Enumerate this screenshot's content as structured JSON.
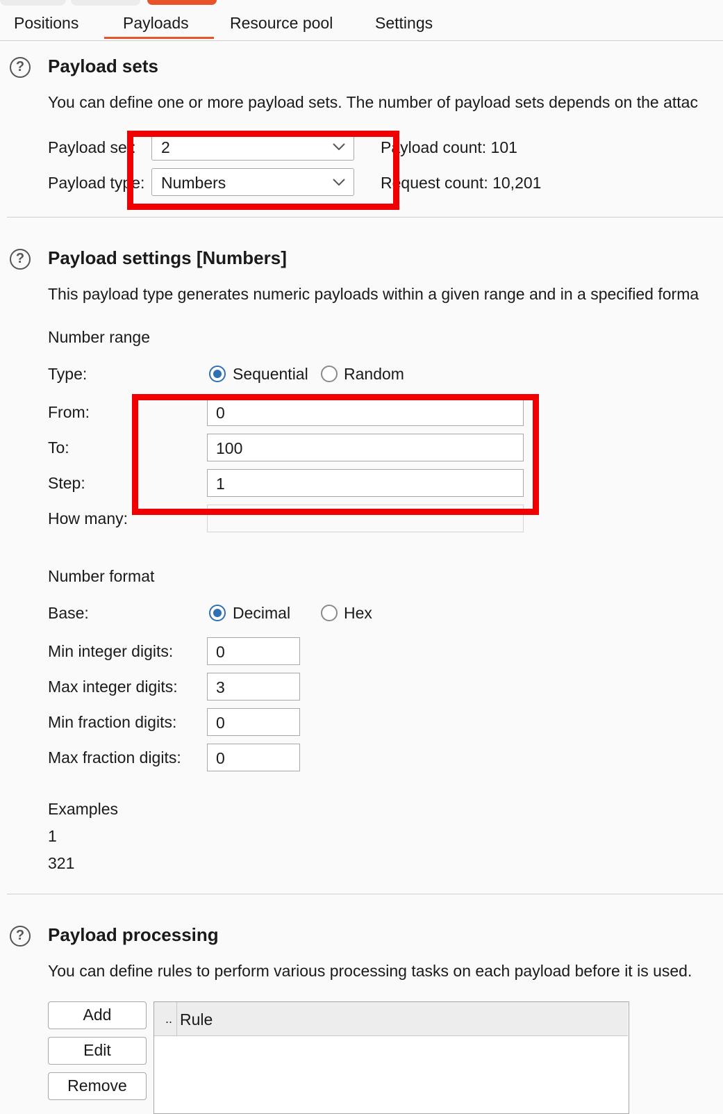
{
  "tabs": [
    {
      "label": "Positions"
    },
    {
      "label": "Payloads"
    },
    {
      "label": "Resource pool"
    },
    {
      "label": "Settings"
    }
  ],
  "payload_sets": {
    "title": "Payload sets",
    "description": "You can define one or more payload sets. The number of payload sets depends on the attac",
    "set_label": "Payload set:",
    "set_value": "2",
    "type_label": "Payload type:",
    "type_value": "Numbers",
    "payload_count": "Payload count:  101",
    "request_count": "Request count:  10,201"
  },
  "payload_settings": {
    "title": "Payload settings [Numbers]",
    "description": "This payload type generates numeric payloads within a given range and in a specified forma",
    "number_range": "Number range",
    "type_label": "Type:",
    "sequential_label": "Sequential",
    "random_label": "Random",
    "from_label": "From:",
    "from_value": "0",
    "to_label": "To:",
    "to_value": "100",
    "step_label": "Step:",
    "step_value": "1",
    "how_many_label": "How many:",
    "how_many_value": "",
    "number_format": "Number format",
    "base_label": "Base:",
    "decimal_label": "Decimal",
    "hex_label": "Hex",
    "min_int_label": "Min integer digits:",
    "min_int_value": "0",
    "max_int_label": "Max integer digits:",
    "max_int_value": "3",
    "min_frac_label": "Min fraction digits:",
    "min_frac_value": "0",
    "max_frac_label": "Max fraction digits:",
    "max_frac_value": "0",
    "examples_label": "Examples",
    "example_1": "1",
    "example_2": "321"
  },
  "payload_processing": {
    "title": "Payload processing",
    "description": "You can define rules to perform various processing tasks on each payload before it is used.",
    "add_label": "Add",
    "edit_label": "Edit",
    "remove_label": "Remove",
    "col_enabled": "..",
    "col_rule": "Rule"
  },
  "colors": {
    "accent": "#e8542a",
    "highlight": "#f00000",
    "radio": "#2f6fb3"
  },
  "icons": {
    "help": "help-circle-icon",
    "chevron": "chevron-down-icon"
  }
}
